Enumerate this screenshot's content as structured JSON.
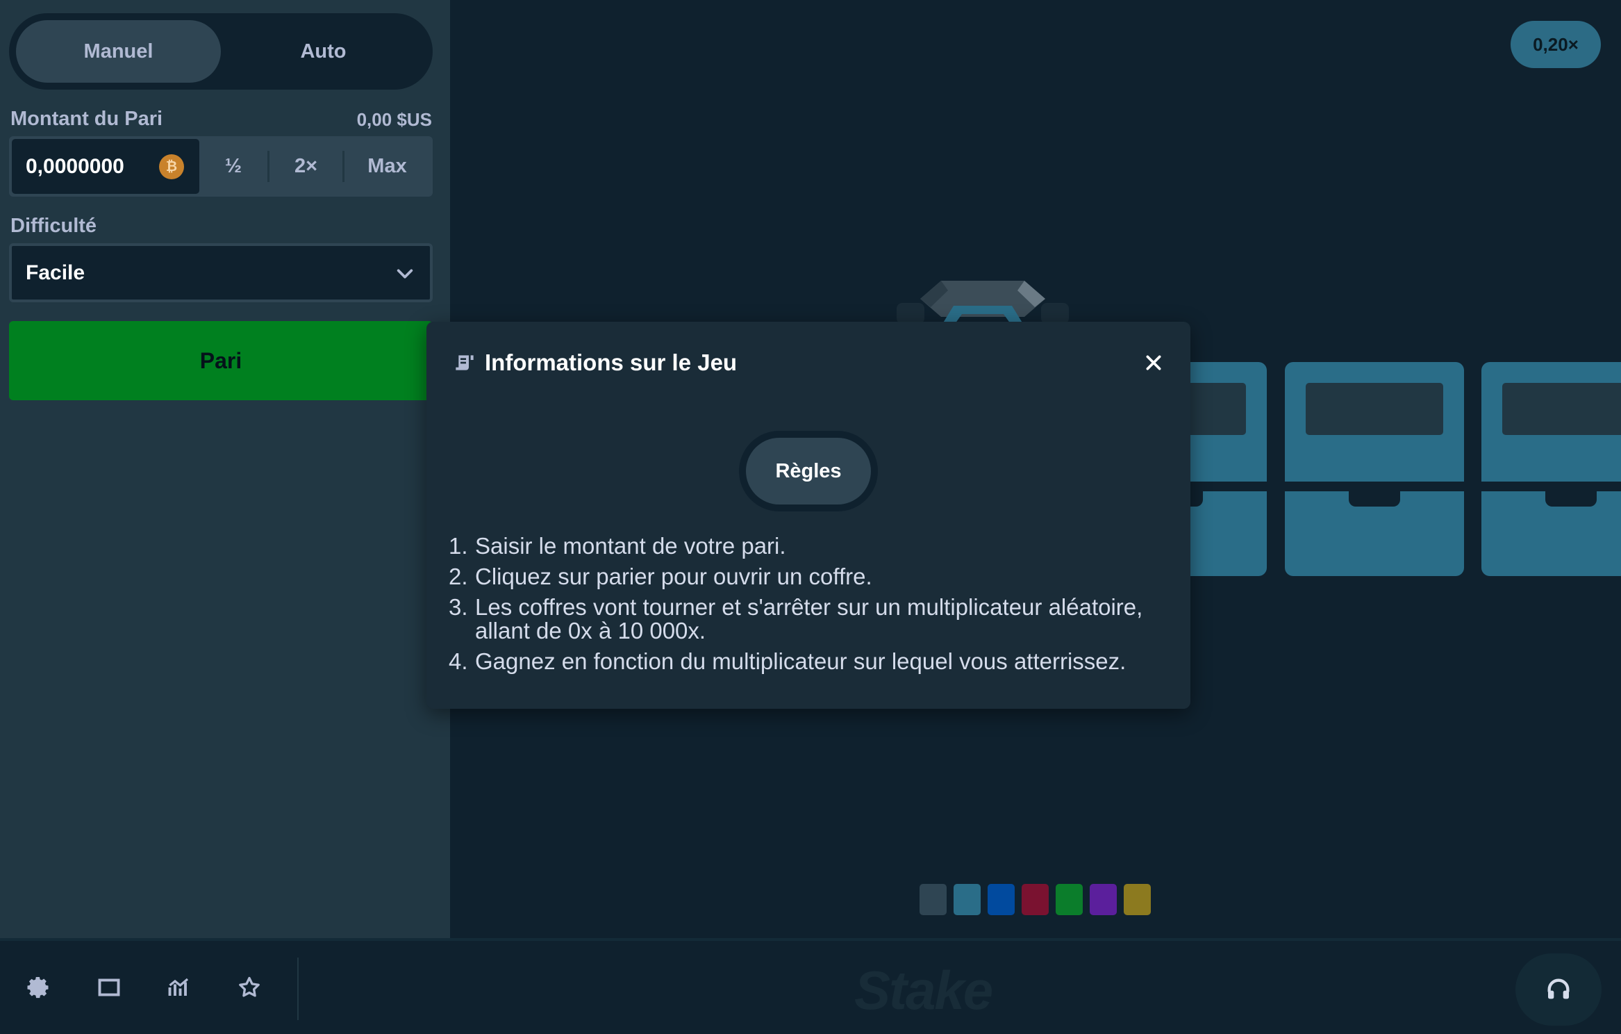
{
  "tabs": [
    "Manuel",
    "Auto"
  ],
  "bet": {
    "label": "Montant du Pari",
    "fiat": "0,00 $US",
    "amount": "0,0000000",
    "currency_icon": "bitcoin-icon",
    "half": "½",
    "double": "2×",
    "max": "Max"
  },
  "difficulty": {
    "label": "Difficulté",
    "value": "Facile"
  },
  "action": {
    "label": "Pari"
  },
  "multiplier": "0,20×",
  "swatches": [
    "#2f4553",
    "#2a6d88",
    "#014a9e",
    "#7a1230",
    "#0b7d2b",
    "#5b1f9c",
    "#8c7a1f"
  ],
  "modal": {
    "title": "Informations sur le Jeu",
    "tab": "Règles",
    "rules": [
      {
        "num": "1.",
        "text": "Saisir le montant de votre pari."
      },
      {
        "num": "2.",
        "text": "Cliquez sur parier pour ouvrir un coffre."
      },
      {
        "num": "3.",
        "text": "Les coffres vont tourner et s'arrêter sur un multiplicateur aléatoire, allant de 0x à 10 000x."
      },
      {
        "num": "4.",
        "text": "Gagnez en fonction du multiplicateur sur lequel vous atterrissez."
      }
    ]
  },
  "footer": {
    "logo": "Stake"
  }
}
